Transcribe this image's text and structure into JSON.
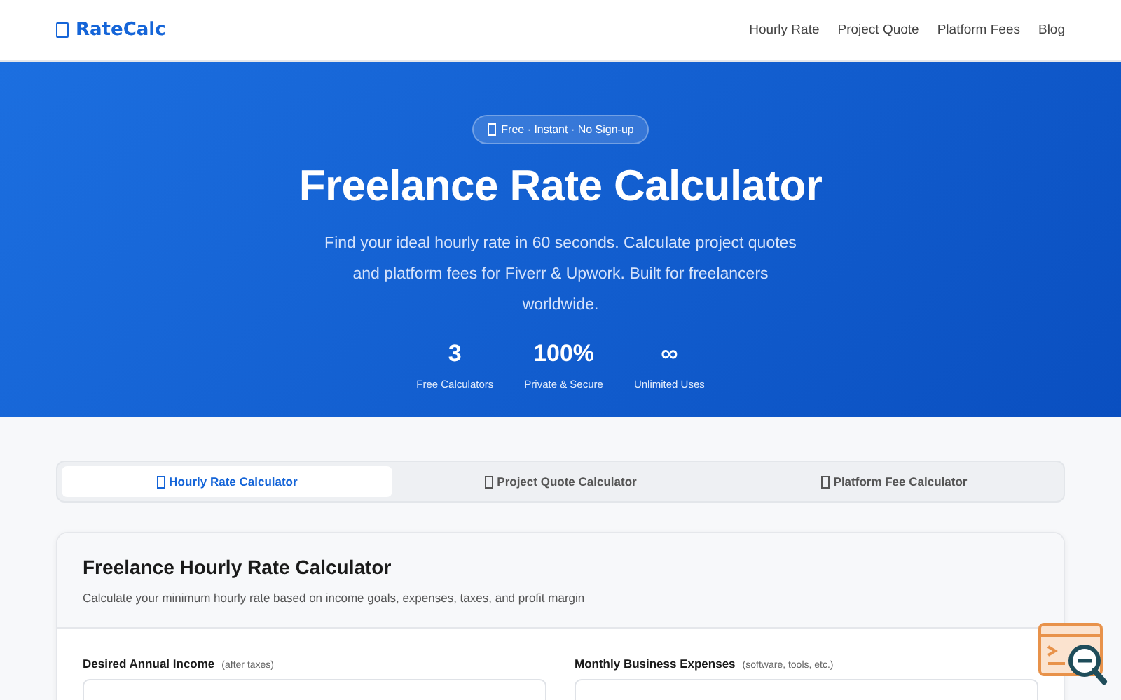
{
  "header": {
    "logo": "RateCalc",
    "nav": [
      {
        "label": "Hourly Rate"
      },
      {
        "label": "Project Quote"
      },
      {
        "label": "Platform Fees"
      },
      {
        "label": "Blog"
      }
    ]
  },
  "hero": {
    "badge": "Free · Instant · No Sign-up",
    "title": "Freelance Rate Calculator",
    "subtitle": "Find your ideal hourly rate in 60 seconds. Calculate project quotes and platform fees for Fiverr & Upwork. Built for freelancers worldwide.",
    "stats": [
      {
        "value": "3",
        "label": "Free Calculators"
      },
      {
        "value": "100%",
        "label": "Private & Secure"
      },
      {
        "value": "∞",
        "label": "Unlimited Uses"
      }
    ]
  },
  "tabs": [
    {
      "label": "Hourly Rate Calculator",
      "selected": true
    },
    {
      "label": "Project Quote Calculator",
      "selected": false
    },
    {
      "label": "Platform Fee Calculator",
      "selected": false
    }
  ],
  "card": {
    "title": "Freelance Hourly Rate Calculator",
    "description": "Calculate your minimum hourly rate based on income goals, expenses, taxes, and profit margin",
    "fields": [
      {
        "label": "Desired Annual Income",
        "hint": "(after taxes)"
      },
      {
        "label": "Monthly Business Expenses",
        "hint": "(software, tools, etc.)"
      }
    ]
  }
}
